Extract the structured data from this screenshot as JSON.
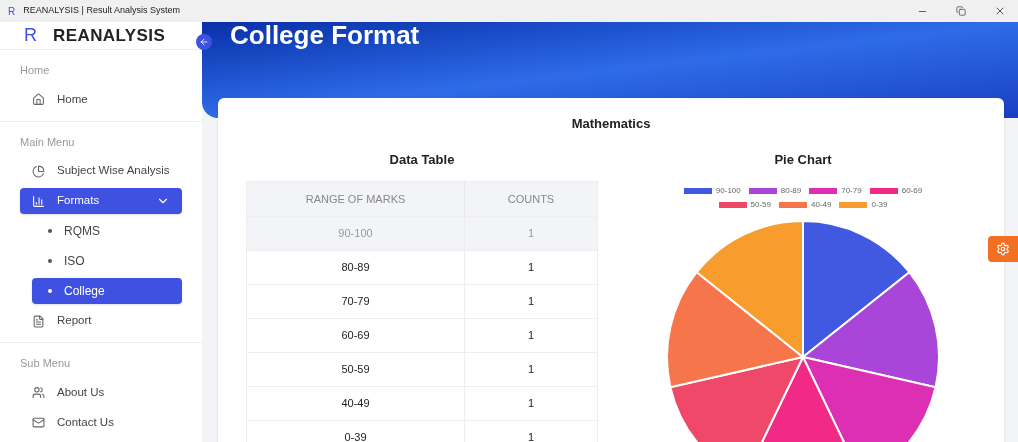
{
  "window": {
    "logo": "R",
    "title": "REANALYSIS | Result Analysis System"
  },
  "sidebar": {
    "brand_letter": "R",
    "brand": "REANALYSIS",
    "sections": [
      {
        "heading": "Home",
        "items": [
          {
            "label": "Home",
            "selected": false
          }
        ]
      },
      {
        "heading": "Main Menu",
        "items": [
          {
            "label": "Subject Wise Analysis",
            "selected": false
          },
          {
            "label": "Formats",
            "selected": true,
            "expanded": true,
            "children": [
              {
                "label": "RQMS",
                "selected": false
              },
              {
                "label": "ISO",
                "selected": false
              },
              {
                "label": "College",
                "selected": true
              }
            ]
          },
          {
            "label": "Report",
            "selected": false
          }
        ]
      },
      {
        "heading": "Sub Menu",
        "items": [
          {
            "label": "About Us",
            "selected": false
          },
          {
            "label": "Contact Us",
            "selected": false
          }
        ]
      }
    ]
  },
  "page_title": "College Format",
  "card": {
    "subject": "Mathematics",
    "table": {
      "title": "Data Table",
      "columns": [
        "RANGE OF MARKS",
        "COUNTS"
      ],
      "rows": [
        {
          "range": "90-100",
          "count": "1",
          "selected": true
        },
        {
          "range": "80-89",
          "count": "1",
          "selected": false
        },
        {
          "range": "70-79",
          "count": "1",
          "selected": false
        },
        {
          "range": "60-69",
          "count": "1",
          "selected": false
        },
        {
          "range": "50-59",
          "count": "1",
          "selected": false
        },
        {
          "range": "40-49",
          "count": "1",
          "selected": false
        },
        {
          "range": "0-39",
          "count": "1",
          "selected": false
        }
      ]
    },
    "chart_data": {
      "type": "pie",
      "title": "Pie Chart",
      "categories": [
        "90-100",
        "80-89",
        "70-79",
        "60-69",
        "50-59",
        "40-49",
        "0-39"
      ],
      "colors": [
        "#4158e0",
        "#a945d8",
        "#dc2fb4",
        "#f02a86",
        "#f04868",
        "#f7754a",
        "#f89c2e"
      ],
      "values": [
        14.29,
        14.29,
        14.29,
        14.28,
        14.29,
        14.28,
        14.28
      ]
    }
  }
}
